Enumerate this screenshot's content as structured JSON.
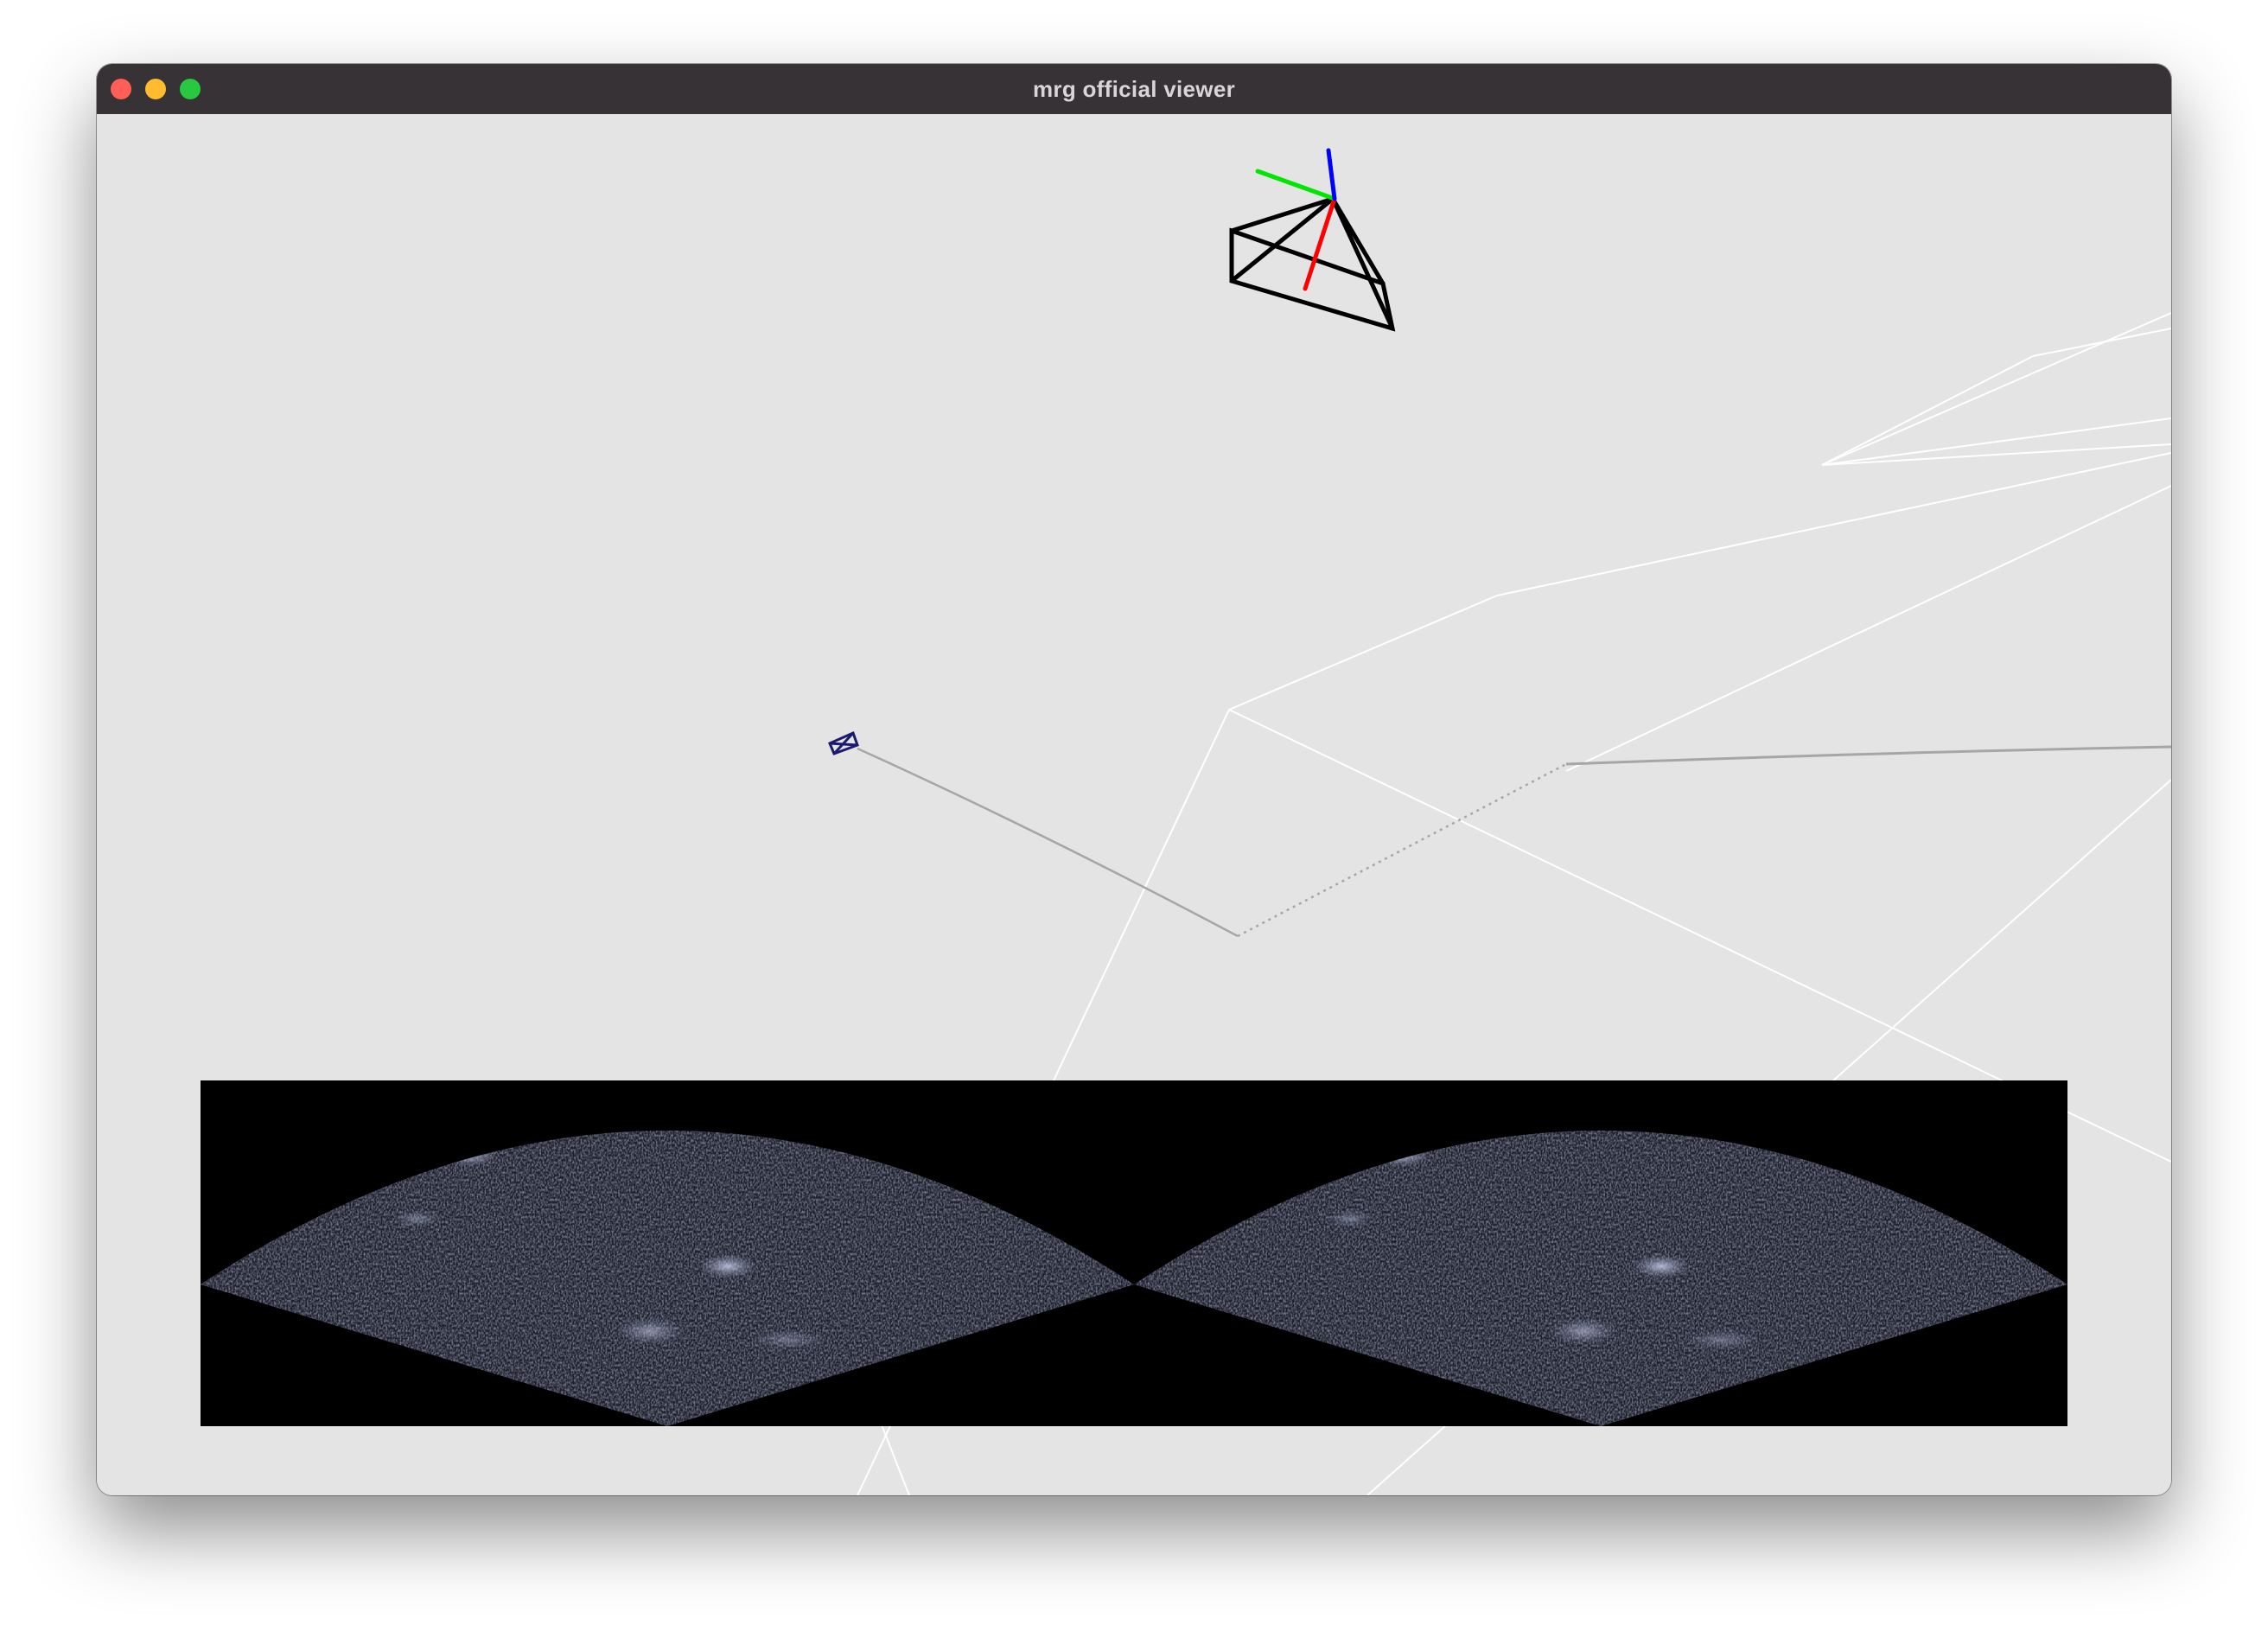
{
  "window": {
    "title": "mrg official viewer",
    "buttons": {
      "close_color": "#ff5f57",
      "minimize_color": "#febc2e",
      "zoom_color": "#28c840"
    }
  },
  "viewer": {
    "background_color": "#e4e4e4",
    "grid_color": "#ffffff",
    "trajectory_color": "#a6a6a6",
    "probe_marker_color": "#1a1a6e",
    "camera_frustum_color": "#000000",
    "axes": {
      "x_color": "#ff0000",
      "y_color": "#00e600",
      "z_color": "#0000ff"
    }
  },
  "ultrasound": {
    "image_count": 2,
    "tint_color": "#8c94b4"
  }
}
